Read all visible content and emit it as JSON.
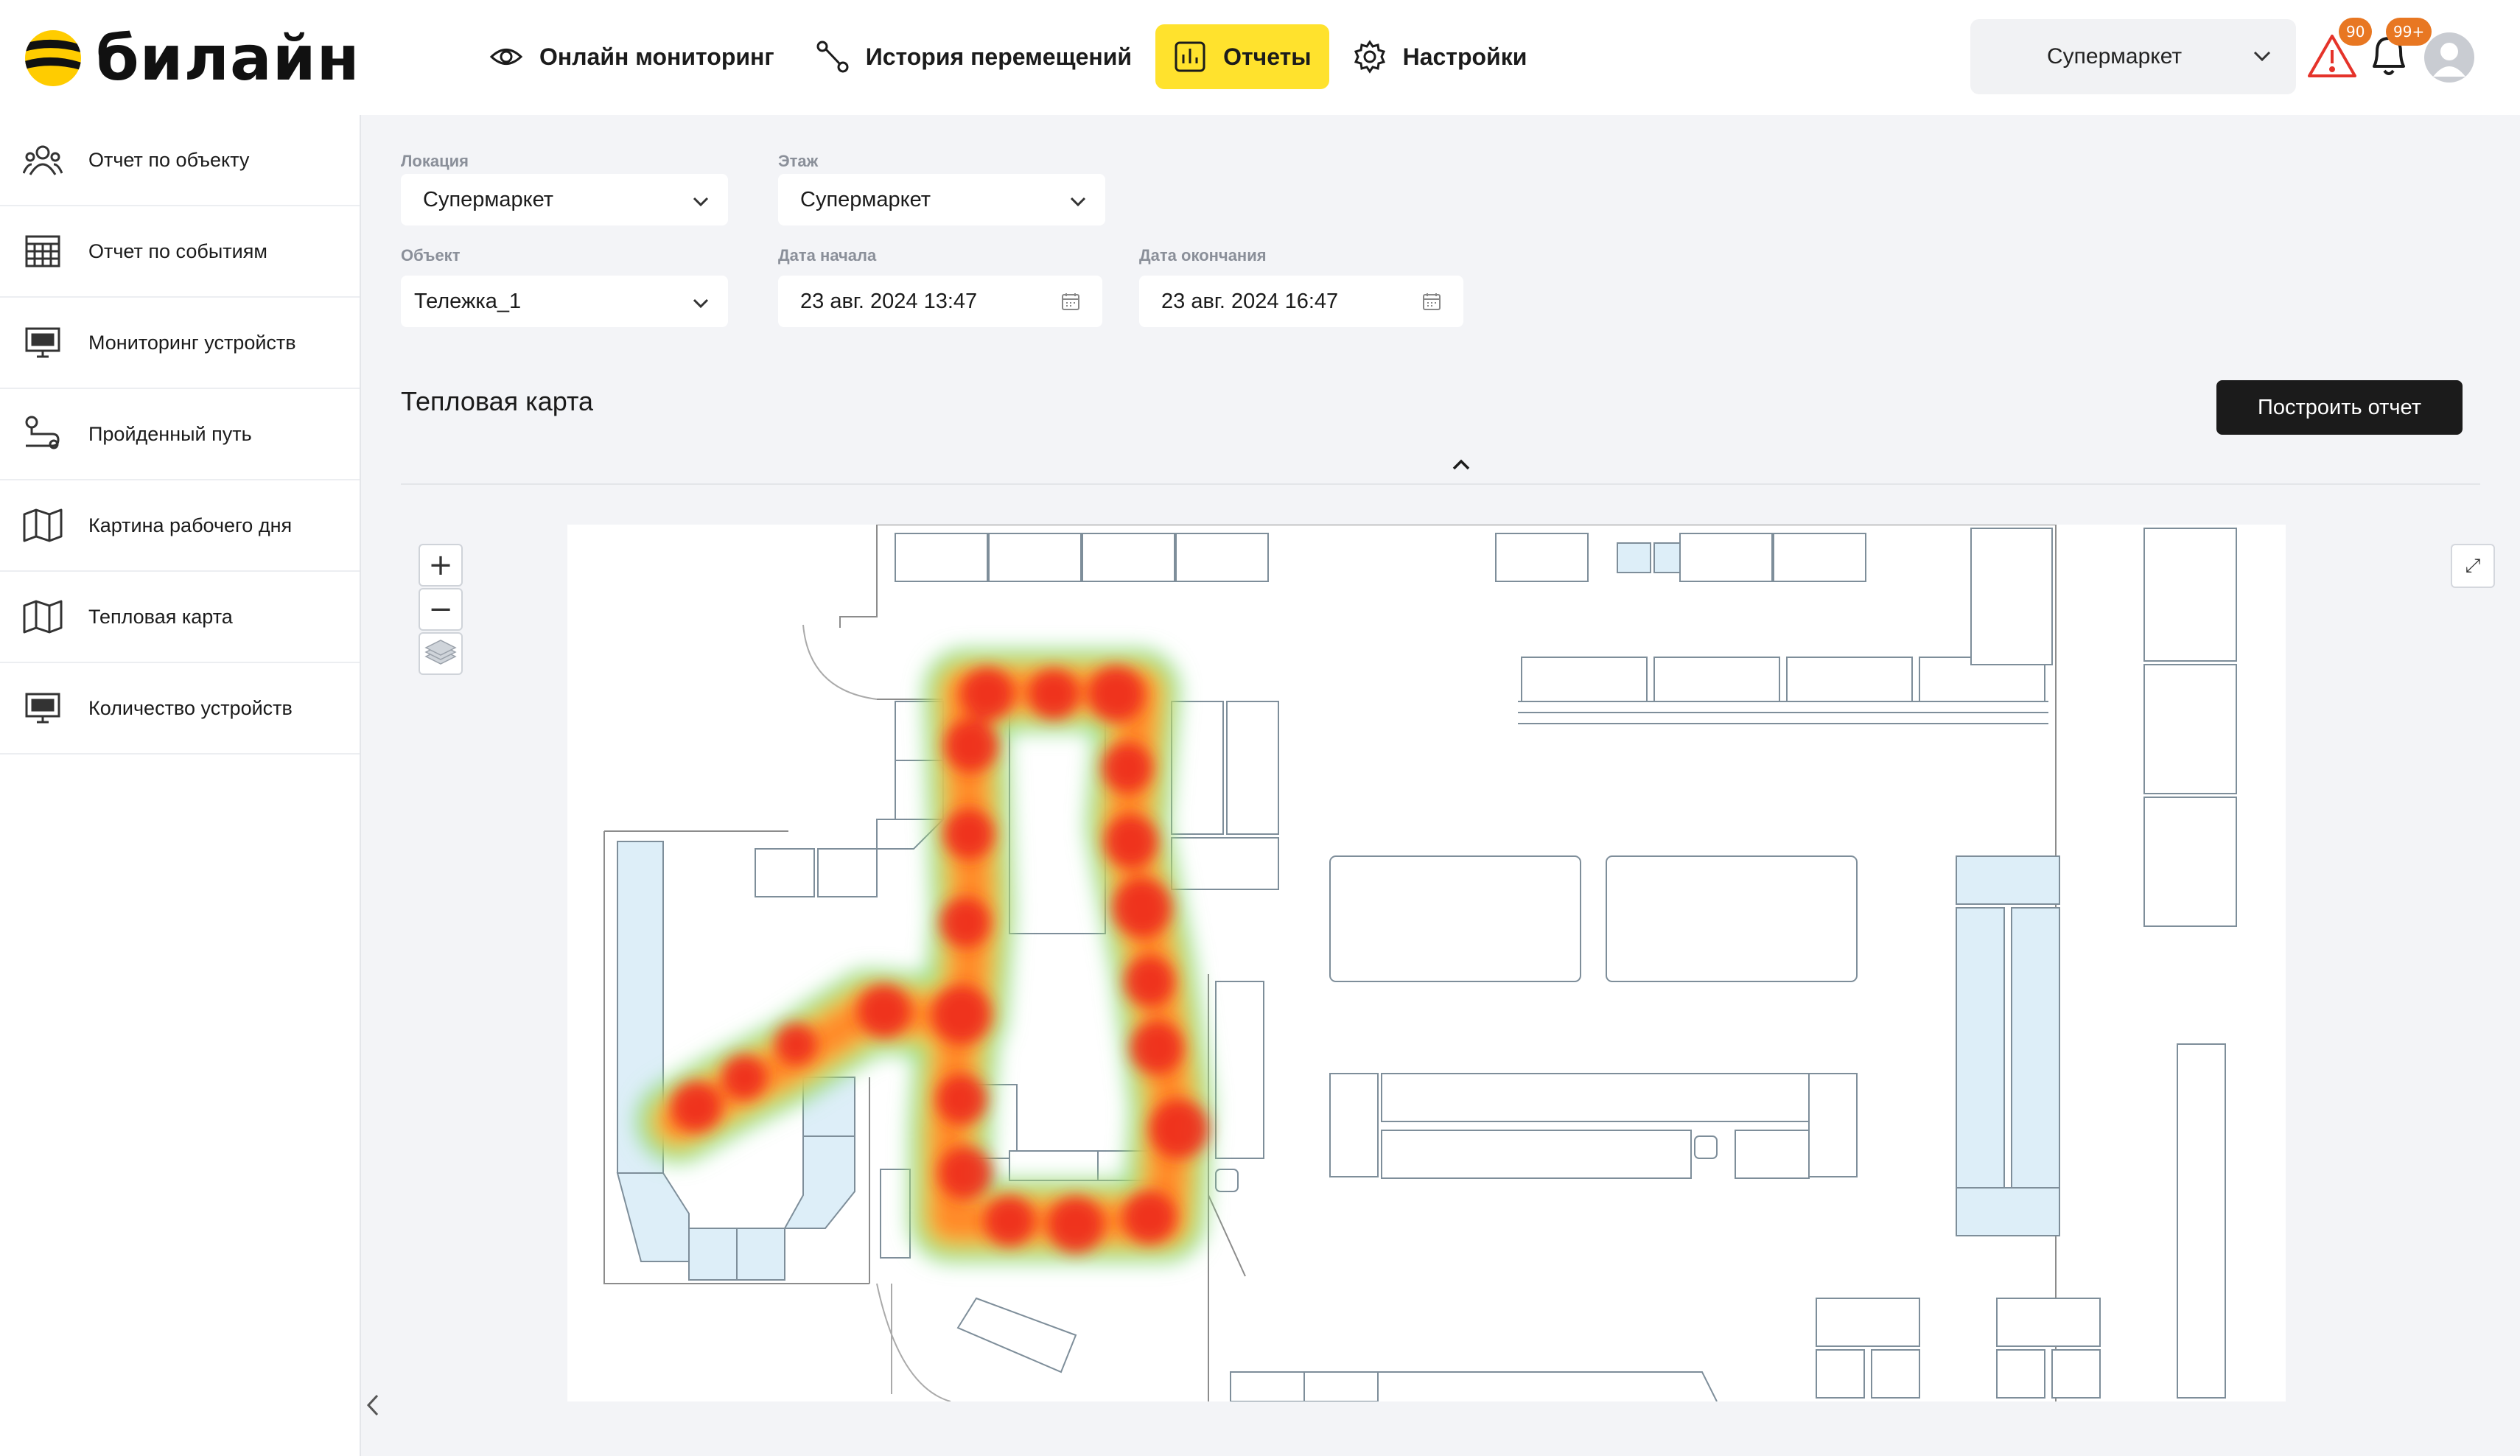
{
  "brand": {
    "name": "билайн",
    "accent": "#ffe22d",
    "logo_colors": [
      "#ffcc00",
      "#111111"
    ]
  },
  "nav": {
    "items": [
      {
        "label": "Онлайн мониторинг",
        "icon": "eye-icon",
        "active": false
      },
      {
        "label": "История перемещений",
        "icon": "route-icon",
        "active": false
      },
      {
        "label": "Отчеты",
        "icon": "chart-icon",
        "active": true
      },
      {
        "label": "Настройки",
        "icon": "gear-icon",
        "active": false
      }
    ]
  },
  "header": {
    "location_select": "Супермаркет",
    "alerts_badge": "90",
    "notifications_badge": "99+"
  },
  "sidebar": {
    "items": [
      {
        "label": "Отчет по объекту",
        "icon": "people-icon"
      },
      {
        "label": "Отчет по событиям",
        "icon": "calendar-grid-icon"
      },
      {
        "label": "Мониторинг устройств",
        "icon": "monitor-icon"
      },
      {
        "label": "Пройденный путь",
        "icon": "path-icon"
      },
      {
        "label": "Картина рабочего дня",
        "icon": "map-icon"
      },
      {
        "label": "Тепловая карта",
        "icon": "map-icon"
      },
      {
        "label": "Количество устройств",
        "icon": "monitor-icon"
      }
    ]
  },
  "form": {
    "location": {
      "label": "Локация",
      "value": "Супермаркет"
    },
    "floor": {
      "label": "Этаж",
      "value": "Супермаркет"
    },
    "object": {
      "label": "Объект",
      "value": "Тележка_1"
    },
    "start_date": {
      "label": "Дата начала",
      "value": "23 авг. 2024 13:47"
    },
    "end_date": {
      "label": "Дата окончания",
      "value": "23 авг. 2024 16:47"
    }
  },
  "section_title": "Тепловая карта",
  "build_button": "Построить отчет",
  "map": {
    "zoom_in": "+",
    "zoom_out": "−",
    "expand": "⤢"
  }
}
